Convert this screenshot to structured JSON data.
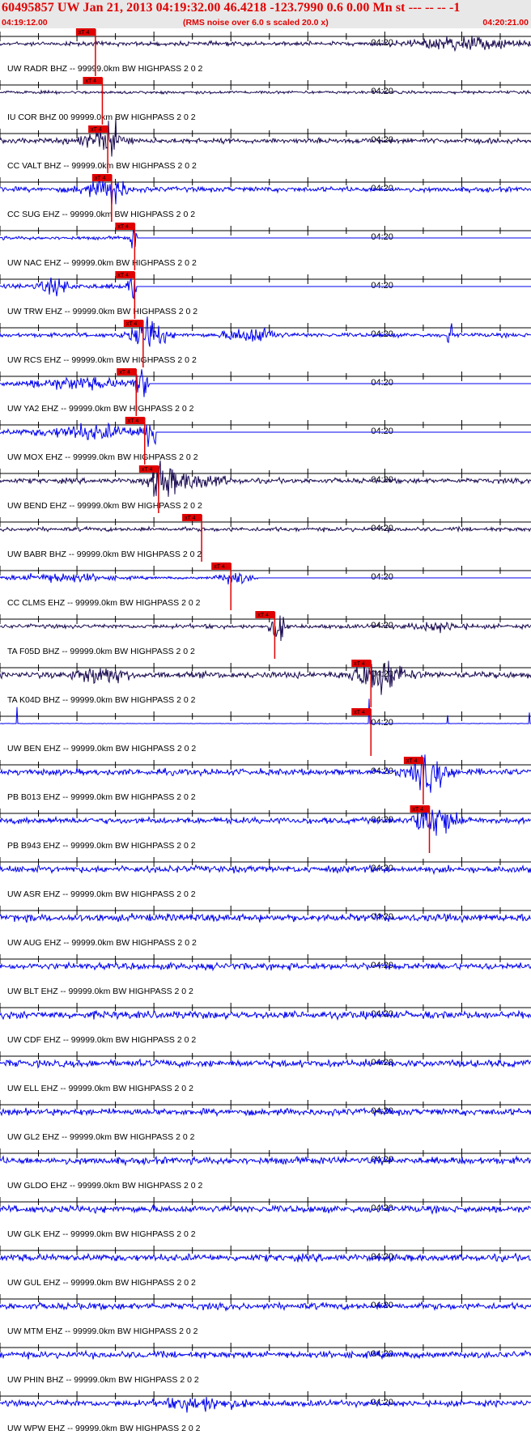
{
  "header": {
    "title": "60495857 UW Jan 21, 2013 04:19:32.00   46.4218 -123.7990  0.6 0.00 Mn st --- -- --   -1",
    "start_time": "04:19:12.00",
    "rms_note": "(RMS noise over 6.0 s scaled 20.0 x)",
    "end_time": "04:20:21.00"
  },
  "colors": {
    "title": "#e00000",
    "pick": "#e00000",
    "trace_dark": "#1a0a50",
    "trace_blue": "#0000ee",
    "axis": "#000000"
  },
  "chart_data": {
    "type": "line",
    "title": "60495857 UW Jan 21, 2013 04:19:32.00   46.4218 -123.7990  0.6 0.00 Mn st --- -- --   -1",
    "x_start": "04:19:12.00",
    "x_end": "04:20:21.00",
    "xlim_seconds": [
      0,
      69
    ],
    "tick_interval_seconds": 5,
    "tick_label": "04:20",
    "tick_label_time_seconds": 48,
    "pick_label": "xT 4",
    "grid": false,
    "legend": "none",
    "series": [
      {
        "name": "UW.RADR.BHZ.--.99999.0km.BW_HIGHPASS_2.0_2",
        "color": "dark",
        "pick": 12.4,
        "noise": 0.1,
        "bursts": [
          [
            60,
            6,
            0.3
          ]
        ]
      },
      {
        "name": "IU.COR.BHZ.00.99999.0km.BW_HIGHPASS_2.0_2",
        "color": "dark",
        "pick": 13.3,
        "noise": 0.07,
        "bursts": []
      },
      {
        "name": "CC.VALT.BHZ.--.99999.0km.BW_HIGHPASS_2.0_2",
        "color": "dark",
        "pick": 14.0,
        "noise": 0.12,
        "bursts": [
          [
            14.5,
            1.2,
            0.75
          ],
          [
            13.0,
            3.0,
            0.3
          ]
        ]
      },
      {
        "name": "CC.SUG.EHZ.--.99999.0km.BW_HIGHPASS_2.0_2",
        "color": "blue",
        "pick": 14.5,
        "noise": 0.12,
        "bursts": [
          [
            15.0,
            1.0,
            0.7
          ],
          [
            13.0,
            3.0,
            0.3
          ]
        ]
      },
      {
        "name": "UW.NAC.EHZ.--.99999.0km.BW_HIGHPASS_2.0_2",
        "color": "blue",
        "pick": 17.5,
        "noise": 0.08,
        "end": 17.8,
        "bursts": [
          [
            17.3,
            0.4,
            0.6
          ]
        ]
      },
      {
        "name": "UW.TRW.EHZ.--.99999.0km.BW_HIGHPASS_2.0_2",
        "color": "blue",
        "pick": 17.5,
        "noise": 0.12,
        "end": 17.7,
        "bursts": [
          [
            17.2,
            0.5,
            0.7
          ],
          [
            7.0,
            2.0,
            0.3
          ]
        ]
      },
      {
        "name": "UW.RCS.EHZ.--.99999.0km.BW_HIGHPASS_2.0_2",
        "color": "blue",
        "pick": 18.6,
        "noise": 0.1,
        "bursts": [
          [
            19.2,
            2.0,
            0.85
          ],
          [
            31.0,
            2.0,
            0.25
          ],
          [
            34.0,
            2.0,
            0.3
          ],
          [
            58.5,
            0.5,
            0.5
          ]
        ]
      },
      {
        "name": "UW.YA2.EHZ.--.99999.0km.BW_HIGHPASS_2.0_2",
        "color": "blue",
        "pick": 17.7,
        "noise": 0.1,
        "end": 19.4,
        "bursts": [
          [
            18.5,
            1.0,
            0.95
          ],
          [
            10.0,
            6.0,
            0.25
          ]
        ]
      },
      {
        "name": "UW.MOX.EHZ.--.99999.0km.BW_HIGHPASS_2.0_2",
        "color": "blue",
        "pick": 18.8,
        "noise": 0.12,
        "end": 20.2,
        "bursts": [
          [
            19.5,
            0.9,
            0.9
          ],
          [
            12.0,
            6.0,
            0.3
          ]
        ]
      },
      {
        "name": "UW.BEND.EHZ.--.99999.0km.BW_HIGHPASS_2.0_2",
        "color": "dark",
        "pick": 20.6,
        "noise": 0.12,
        "bursts": [
          [
            21.0,
            1.6,
            0.8
          ],
          [
            25.0,
            4.0,
            0.35
          ]
        ]
      },
      {
        "name": "UW.BABR.BHZ.--.99999.0km.BW_HIGHPASS_2.0_2",
        "color": "dark",
        "pick": 26.2,
        "noise": 0.1,
        "bursts": []
      },
      {
        "name": "CC.CLMS.EHZ.--.99999.0km.BW_HIGHPASS_2.0_2",
        "color": "blue",
        "pick": 30.0,
        "noise": 0.06,
        "end": 33.5,
        "bursts": [
          [
            8.0,
            6.0,
            0.2
          ],
          [
            30.5,
            2.0,
            0.3
          ]
        ]
      },
      {
        "name": "TA.F05D.BHZ.--.99999.0km.BW_HIGHPASS_2.0_2",
        "color": "dark",
        "pick": 35.7,
        "noise": 0.1,
        "bursts": [
          [
            36.1,
            0.8,
            0.8
          ],
          [
            57.0,
            3.0,
            0.2
          ]
        ]
      },
      {
        "name": "TA.K04D.BHZ.--.99999.0km.BW_HIGHPASS_2.0_2",
        "color": "dark",
        "pick": 48.2,
        "noise": 0.15,
        "bursts": [
          [
            49.2,
            3.0,
            0.9
          ],
          [
            13.0,
            3.0,
            0.4
          ]
        ]
      },
      {
        "name": "UW.BEN.EHZ.--.99999.0km.BW_HIGHPASS_2.0_2",
        "color": "blue",
        "pick": 48.2,
        "noise": 0.01,
        "bursts": [],
        "spikes": [
          [
            2.2,
            0.6
          ],
          [
            48.0,
            0.9
          ],
          [
            58.2,
            0.3
          ],
          [
            68.8,
            0.4
          ]
        ]
      },
      {
        "name": "PB.B013.EHZ.--.99999.0km.BW_HIGHPASS_2.0_2",
        "color": "blue",
        "pick": 55.0,
        "noise": 0.15,
        "bursts": [
          [
            55.8,
            2.5,
            0.8
          ]
        ]
      },
      {
        "name": "PB.B943.EHZ.--.99999.0km.BW_HIGHPASS_2.0_2",
        "color": "blue",
        "pick": 55.8,
        "noise": 0.15,
        "bursts": [
          [
            56.5,
            2.5,
            0.85
          ]
        ]
      },
      {
        "name": "UW.ASR.EHZ.--.99999.0km.BW_HIGHPASS_2.0_2",
        "color": "blue",
        "noise": 0.16,
        "bursts": []
      },
      {
        "name": "UW.AUG.EHZ.--.99999.0km.BW_HIGHPASS_2.0_2",
        "color": "blue",
        "noise": 0.18,
        "bursts": []
      },
      {
        "name": "UW.BLT.EHZ.--.99999.0km.BW_HIGHPASS_2.0_2",
        "color": "blue",
        "noise": 0.16,
        "bursts": []
      },
      {
        "name": "UW.CDF.EHZ.--.99999.0km.BW_HIGHPASS_2.0_2",
        "color": "blue",
        "noise": 0.18,
        "bursts": []
      },
      {
        "name": "UW.ELL.EHZ.--.99999.0km.BW_HIGHPASS_2.0_2",
        "color": "blue",
        "noise": 0.17,
        "bursts": []
      },
      {
        "name": "UW.GL2.EHZ.--.99999.0km.BW_HIGHPASS_2.0_2",
        "color": "blue",
        "noise": 0.16,
        "bursts": []
      },
      {
        "name": "UW.GLDO.EHZ.--.99999.0km.BW_HIGHPASS_2.0_2",
        "color": "blue",
        "noise": 0.17,
        "bursts": []
      },
      {
        "name": "UW.GLK.EHZ.--.99999.0km.BW_HIGHPASS_2.0_2",
        "color": "blue",
        "noise": 0.17,
        "bursts": []
      },
      {
        "name": "UW.GUL.EHZ.--.99999.0km.BW_HIGHPASS_2.0_2",
        "color": "blue",
        "noise": 0.17,
        "bursts": []
      },
      {
        "name": "UW.MTM.EHZ.--.99999.0km.BW_HIGHPASS_2.0_2",
        "color": "blue",
        "noise": 0.16,
        "bursts": []
      },
      {
        "name": "UW.PHIN.BHZ.--.99999.0km.BW_HIGHPASS_2.0_2",
        "color": "blue",
        "noise": 0.16,
        "bursts": []
      },
      {
        "name": "UW.WPW.EHZ.--.99999.0km.BW_HIGHPASS_2.0_2",
        "color": "blue",
        "noise": 0.15,
        "bursts": [
          [
            26.0,
            4.0,
            0.3
          ]
        ]
      }
    ]
  }
}
